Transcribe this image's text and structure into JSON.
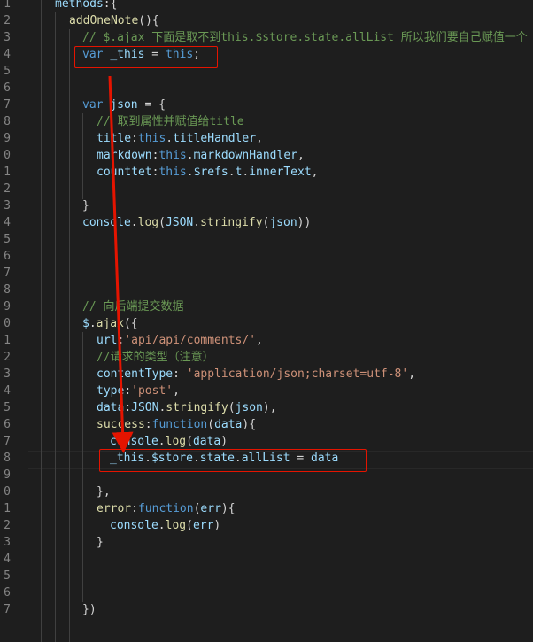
{
  "editor": {
    "line_numbers": [
      "1",
      "2",
      "3",
      "4",
      "5",
      "6",
      "7",
      "8",
      "9",
      "0",
      "1",
      "2",
      "3",
      "4",
      "5",
      "6",
      "7",
      "8",
      "9",
      "0",
      "1",
      "2",
      "3",
      "4",
      "5",
      "6",
      "7",
      "8",
      "9",
      "0",
      "1",
      "2",
      "3",
      "4",
      "5",
      "6",
      "7"
    ],
    "lines": [
      {
        "indent": 62,
        "tokens": [
          {
            "t": "vr",
            "v": "methods"
          },
          {
            "t": "pl",
            "v": ":{"
          }
        ]
      },
      {
        "indent": 78,
        "tokens": [
          {
            "t": "fn",
            "v": "addOneNote"
          },
          {
            "t": "pl",
            "v": "(){"
          }
        ]
      },
      {
        "indent": 93,
        "tokens": [
          {
            "t": "cm",
            "v": "// $.ajax 下面是取不到this.$store.state.allList 所以我们要自己赋值一个"
          }
        ]
      },
      {
        "indent": 93,
        "tokens": [
          {
            "t": "kw",
            "v": "var"
          },
          {
            "t": "pl",
            "v": " "
          },
          {
            "t": "vr",
            "v": "_this"
          },
          {
            "t": "pl",
            "v": " = "
          },
          {
            "t": "kw",
            "v": "this"
          },
          {
            "t": "pl",
            "v": ";"
          }
        ]
      },
      {
        "indent": 93,
        "tokens": []
      },
      {
        "indent": 93,
        "tokens": []
      },
      {
        "indent": 93,
        "tokens": [
          {
            "t": "kw",
            "v": "var"
          },
          {
            "t": "pl",
            "v": " "
          },
          {
            "t": "vr",
            "v": "json"
          },
          {
            "t": "pl",
            "v": " = {"
          }
        ]
      },
      {
        "indent": 109,
        "tokens": [
          {
            "t": "cm",
            "v": "// 取到属性并赋值给title"
          }
        ]
      },
      {
        "indent": 109,
        "tokens": [
          {
            "t": "vr",
            "v": "title"
          },
          {
            "t": "pl",
            "v": ":"
          },
          {
            "t": "kw",
            "v": "this"
          },
          {
            "t": "pl",
            "v": "."
          },
          {
            "t": "vr",
            "v": "titleHandler"
          },
          {
            "t": "pl",
            "v": ","
          }
        ]
      },
      {
        "indent": 109,
        "tokens": [
          {
            "t": "vr",
            "v": "markdown"
          },
          {
            "t": "pl",
            "v": ":"
          },
          {
            "t": "kw",
            "v": "this"
          },
          {
            "t": "pl",
            "v": "."
          },
          {
            "t": "vr",
            "v": "markdownHandler"
          },
          {
            "t": "pl",
            "v": ","
          }
        ]
      },
      {
        "indent": 109,
        "tokens": [
          {
            "t": "vr",
            "v": "counttet"
          },
          {
            "t": "pl",
            "v": ":"
          },
          {
            "t": "kw",
            "v": "this"
          },
          {
            "t": "pl",
            "v": "."
          },
          {
            "t": "vr",
            "v": "$refs"
          },
          {
            "t": "pl",
            "v": "."
          },
          {
            "t": "vr",
            "v": "t"
          },
          {
            "t": "pl",
            "v": "."
          },
          {
            "t": "vr",
            "v": "innerText"
          },
          {
            "t": "pl",
            "v": ","
          }
        ]
      },
      {
        "indent": 93,
        "tokens": []
      },
      {
        "indent": 93,
        "tokens": [
          {
            "t": "pl",
            "v": "}"
          }
        ]
      },
      {
        "indent": 93,
        "tokens": [
          {
            "t": "vr",
            "v": "console"
          },
          {
            "t": "pl",
            "v": "."
          },
          {
            "t": "fn",
            "v": "log"
          },
          {
            "t": "pl",
            "v": "("
          },
          {
            "t": "vr",
            "v": "JSON"
          },
          {
            "t": "pl",
            "v": "."
          },
          {
            "t": "fn",
            "v": "stringify"
          },
          {
            "t": "pl",
            "v": "("
          },
          {
            "t": "vr",
            "v": "json"
          },
          {
            "t": "pl",
            "v": "))"
          }
        ]
      },
      {
        "indent": 93,
        "tokens": []
      },
      {
        "indent": 93,
        "tokens": []
      },
      {
        "indent": 93,
        "tokens": []
      },
      {
        "indent": 93,
        "tokens": []
      },
      {
        "indent": 93,
        "tokens": [
          {
            "t": "cm",
            "v": "// 向后端提交数据"
          }
        ]
      },
      {
        "indent": 93,
        "tokens": [
          {
            "t": "vr",
            "v": "$"
          },
          {
            "t": "pl",
            "v": "."
          },
          {
            "t": "fn",
            "v": "ajax"
          },
          {
            "t": "pl",
            "v": "({"
          }
        ]
      },
      {
        "indent": 109,
        "tokens": [
          {
            "t": "vr",
            "v": "url"
          },
          {
            "t": "pl",
            "v": ":"
          },
          {
            "t": "st",
            "v": "'api/api/comments/'"
          },
          {
            "t": "pl",
            "v": ","
          }
        ]
      },
      {
        "indent": 109,
        "tokens": [
          {
            "t": "cm",
            "v": "//请求的类型（注意）"
          }
        ]
      },
      {
        "indent": 109,
        "tokens": [
          {
            "t": "vr",
            "v": "contentType"
          },
          {
            "t": "pl",
            "v": ": "
          },
          {
            "t": "st",
            "v": "'application/json;charset=utf-8'"
          },
          {
            "t": "pl",
            "v": ","
          }
        ]
      },
      {
        "indent": 109,
        "tokens": [
          {
            "t": "vr",
            "v": "type"
          },
          {
            "t": "pl",
            "v": ":"
          },
          {
            "t": "st",
            "v": "'post'"
          },
          {
            "t": "pl",
            "v": ","
          }
        ]
      },
      {
        "indent": 109,
        "tokens": [
          {
            "t": "vr",
            "v": "data"
          },
          {
            "t": "pl",
            "v": ":"
          },
          {
            "t": "vr",
            "v": "JSON"
          },
          {
            "t": "pl",
            "v": "."
          },
          {
            "t": "fn",
            "v": "stringify"
          },
          {
            "t": "pl",
            "v": "("
          },
          {
            "t": "vr",
            "v": "json"
          },
          {
            "t": "pl",
            "v": "),"
          }
        ]
      },
      {
        "indent": 109,
        "tokens": [
          {
            "t": "fn",
            "v": "success"
          },
          {
            "t": "pl",
            "v": ":"
          },
          {
            "t": "kw",
            "v": "function"
          },
          {
            "t": "pl",
            "v": "("
          },
          {
            "t": "vr",
            "v": "data"
          },
          {
            "t": "pl",
            "v": "){"
          }
        ]
      },
      {
        "indent": 124,
        "tokens": [
          {
            "t": "vr",
            "v": "console"
          },
          {
            "t": "pl",
            "v": "."
          },
          {
            "t": "fn",
            "v": "log"
          },
          {
            "t": "pl",
            "v": "("
          },
          {
            "t": "vr",
            "v": "data"
          },
          {
            "t": "pl",
            "v": ")"
          }
        ]
      },
      {
        "indent": 124,
        "tokens": [
          {
            "t": "vr",
            "v": "_this"
          },
          {
            "t": "pl",
            "v": "."
          },
          {
            "t": "vr",
            "v": "$store"
          },
          {
            "t": "pl",
            "v": "."
          },
          {
            "t": "vr",
            "v": "state"
          },
          {
            "t": "pl",
            "v": "."
          },
          {
            "t": "vr",
            "v": "allList"
          },
          {
            "t": "pl",
            "v": " = "
          },
          {
            "t": "vr",
            "v": "data"
          }
        ]
      },
      {
        "indent": 124,
        "tokens": []
      },
      {
        "indent": 109,
        "tokens": [
          {
            "t": "pl",
            "v": "},"
          }
        ]
      },
      {
        "indent": 109,
        "tokens": [
          {
            "t": "fn",
            "v": "error"
          },
          {
            "t": "pl",
            "v": ":"
          },
          {
            "t": "kw",
            "v": "function"
          },
          {
            "t": "pl",
            "v": "("
          },
          {
            "t": "vr",
            "v": "err"
          },
          {
            "t": "pl",
            "v": "){"
          }
        ]
      },
      {
        "indent": 124,
        "tokens": [
          {
            "t": "vr",
            "v": "console"
          },
          {
            "t": "pl",
            "v": "."
          },
          {
            "t": "fn",
            "v": "log"
          },
          {
            "t": "pl",
            "v": "("
          },
          {
            "t": "vr",
            "v": "err"
          },
          {
            "t": "pl",
            "v": ")"
          }
        ]
      },
      {
        "indent": 109,
        "tokens": [
          {
            "t": "pl",
            "v": "}"
          }
        ]
      },
      {
        "indent": 109,
        "tokens": []
      },
      {
        "indent": 93,
        "tokens": []
      },
      {
        "indent": 93,
        "tokens": []
      },
      {
        "indent": 93,
        "tokens": [
          {
            "t": "pl",
            "v": "})"
          }
        ]
      }
    ]
  },
  "annotations": {
    "highlight_color": "#e51400",
    "arrow_color": "#e51400"
  }
}
